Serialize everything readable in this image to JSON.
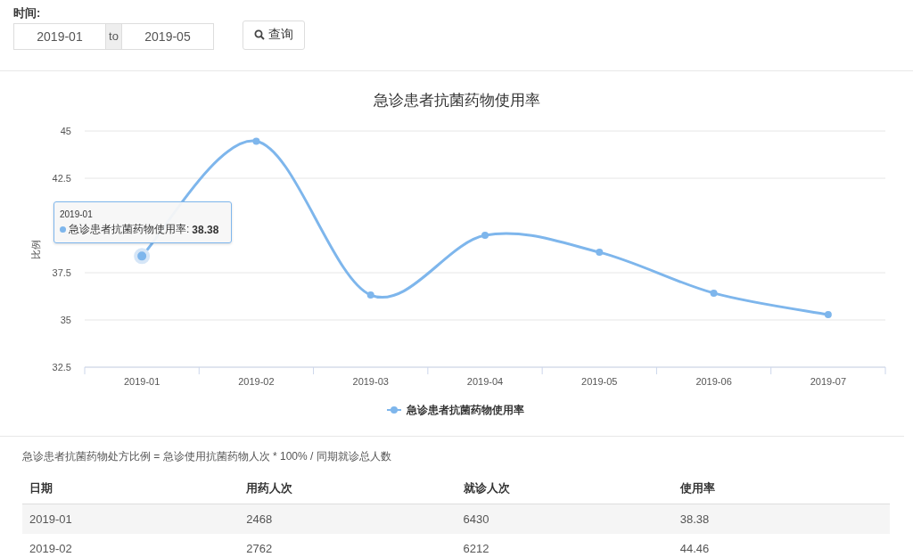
{
  "filter": {
    "label": "时间:",
    "start": "2019-01",
    "separator": "to",
    "end": "2019-05",
    "query_button": "查询"
  },
  "chart": {
    "chart_data": {
      "type": "line",
      "title": "急诊患者抗菌药物使用率",
      "ylabel": "比例",
      "categories": [
        "2019-01",
        "2019-02",
        "2019-03",
        "2019-04",
        "2019-05",
        "2019-06",
        "2019-07"
      ],
      "series": [
        {
          "name": "急诊患者抗菌药物使用率",
          "color": "#7eb6ec",
          "marker": true,
          "values": [
            38.38,
            44.46,
            36.32,
            39.48,
            38.58,
            36.42,
            35.28
          ]
        }
      ],
      "grid": true,
      "ylim": [
        32.5,
        45
      ],
      "yticks": [
        32.5,
        35,
        37.5,
        42.5,
        45
      ]
    },
    "markers": [
      {
        "highlighted": true
      },
      {
        "highlighted": false
      },
      {
        "highlighted": false
      },
      {
        "highlighted": false
      },
      {
        "highlighted": false
      },
      {
        "highlighted": false
      },
      {
        "highlighted": false
      }
    ],
    "tooltip": {
      "title": "2019-01",
      "label": "急诊患者抗菌药物使用率:",
      "value": "38.38"
    }
  },
  "formula": "急诊患者抗菌药物处方比例 = 急诊使用抗菌药物人次 * 100% / 同期就诊总人数",
  "table": {
    "columns": [
      "日期",
      "用药人次",
      "就诊人次",
      "使用率"
    ],
    "rows": [
      [
        "2019-01",
        "2468",
        "6430",
        "38.38"
      ],
      [
        "2019-02",
        "2762",
        "6212",
        "44.46"
      ]
    ]
  }
}
